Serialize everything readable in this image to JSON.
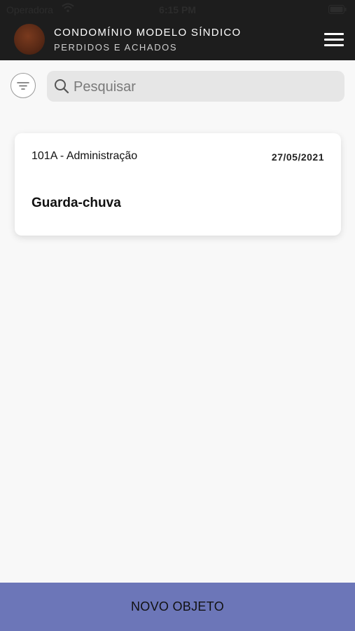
{
  "status_bar": {
    "carrier": "Operadora",
    "time": "6:15 PM"
  },
  "header": {
    "title": "CONDOMÍNIO MODELO SÍNDICO",
    "subtitle": "PERDIDOS E ACHADOS",
    "avatar_color": "#6b3019",
    "background_color": "#1d1d1d",
    "menu_icon": "hamburger-icon"
  },
  "toolbar": {
    "filter_icon": "filter-icon",
    "search_icon": "search-icon",
    "search_placeholder": "Pesquisar",
    "search_value": ""
  },
  "items": [
    {
      "unit": "101A - Administração",
      "date": "27/05/2021",
      "name": "Guarda-chuva"
    }
  ],
  "footer": {
    "button_label": "NOVO OBJETO",
    "button_color": "#6c76b8"
  }
}
